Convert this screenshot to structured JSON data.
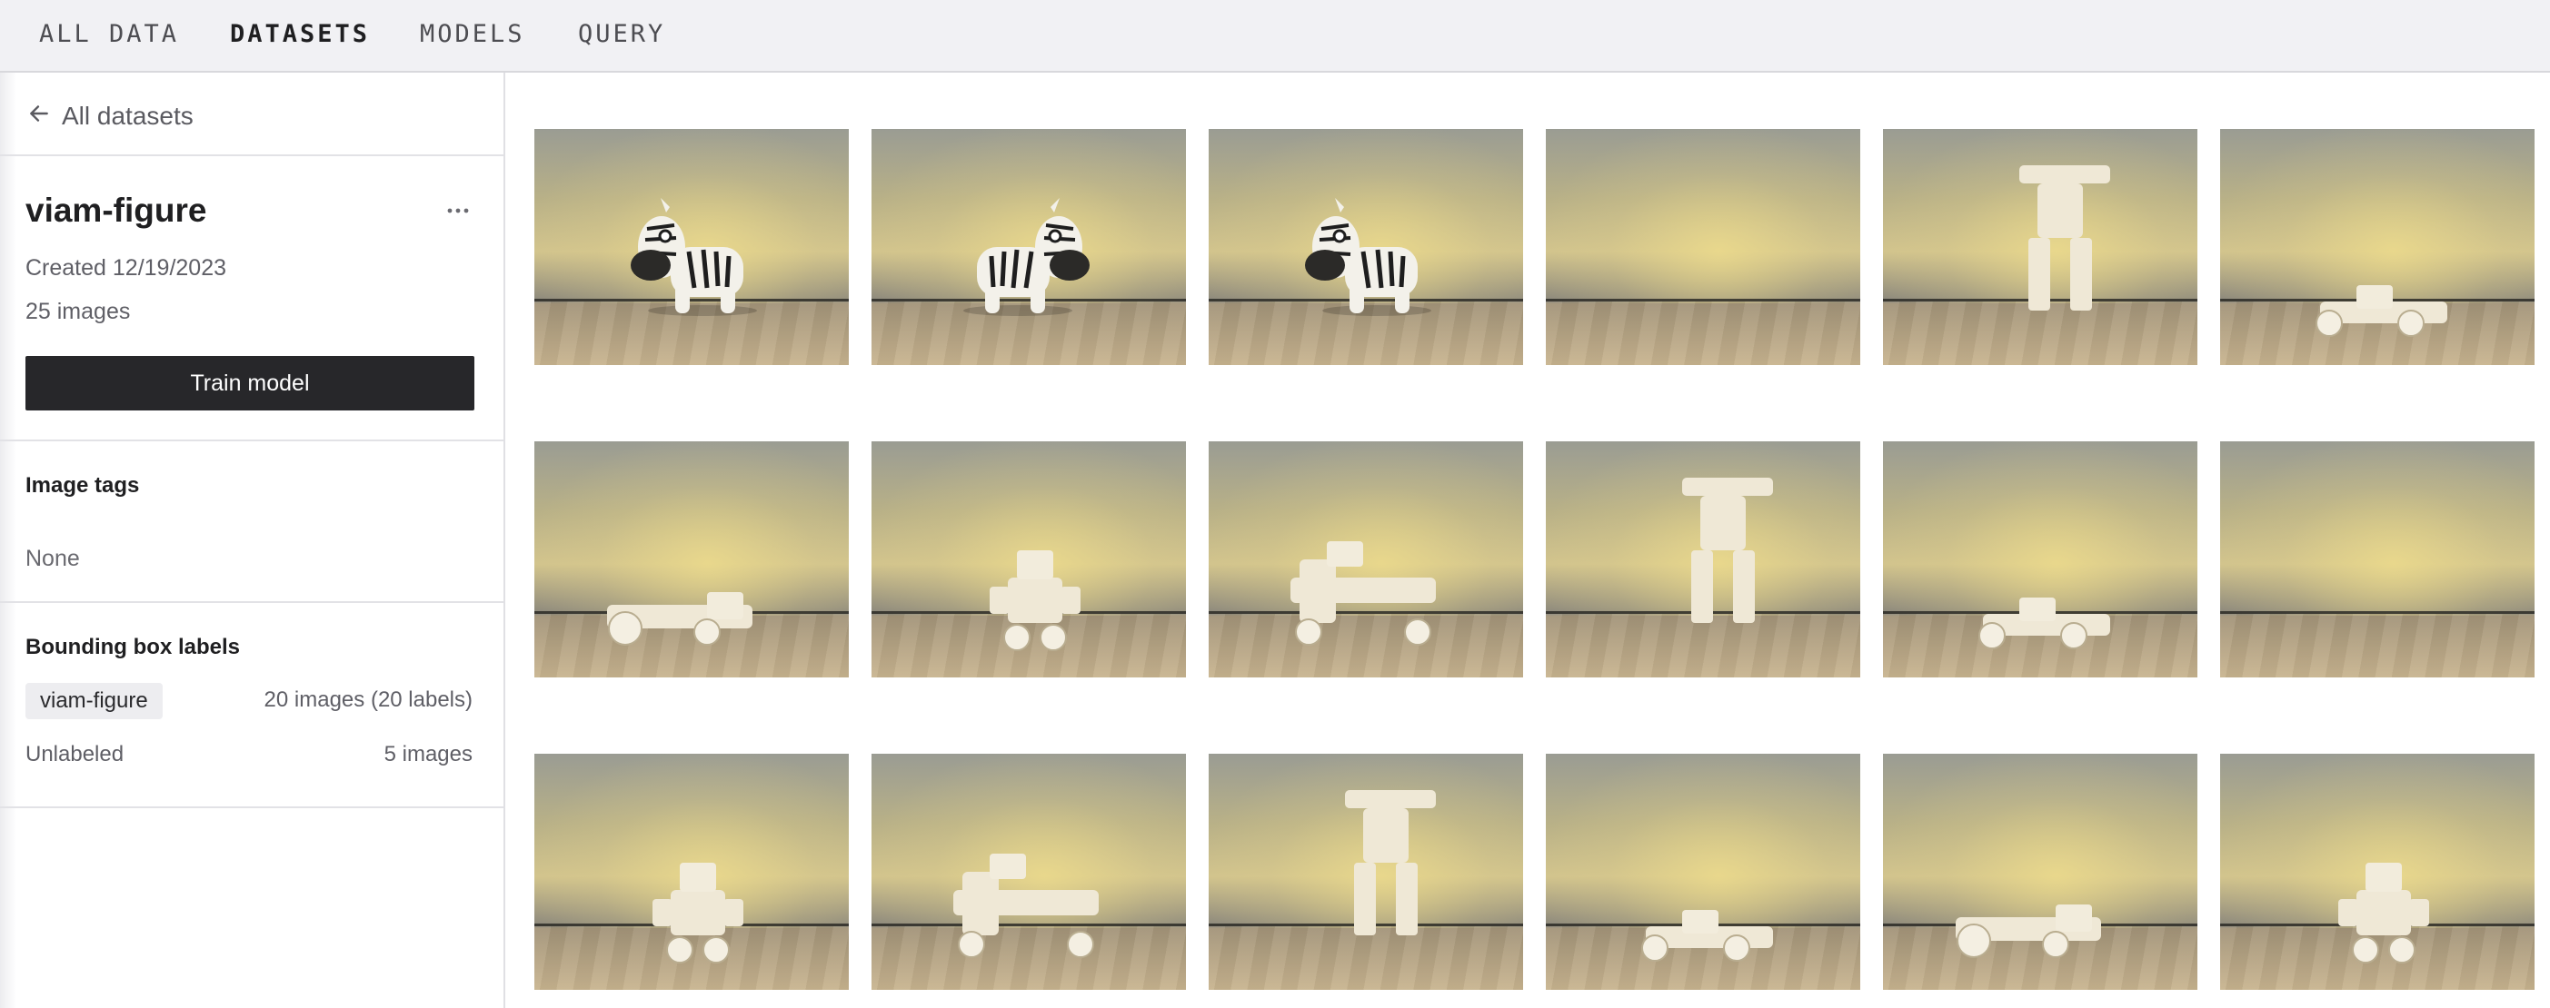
{
  "nav": {
    "tabs": [
      "ALL DATA",
      "DATASETS",
      "MODELS",
      "QUERY"
    ],
    "active": "DATASETS"
  },
  "sidebar": {
    "back_label": "All datasets",
    "dataset_name": "viam-figure",
    "created": "Created 12/19/2023",
    "image_count": "25 images",
    "train_button": "Train model",
    "image_tags_title": "Image tags",
    "image_tags_value": "None",
    "bbox_title": "Bounding box labels",
    "labels": [
      {
        "name": "viam-figure",
        "count": "20 images (20 labels)"
      }
    ],
    "unlabeled": {
      "label": "Unlabeled",
      "count": "5 images"
    }
  },
  "grid": {
    "images": [
      {
        "subject": "zebra"
      },
      {
        "subject": "zebra"
      },
      {
        "subject": "zebra"
      },
      {
        "subject": "empty"
      },
      {
        "subject": "figure"
      },
      {
        "subject": "figure"
      },
      {
        "subject": "figure"
      },
      {
        "subject": "figure"
      },
      {
        "subject": "figure"
      },
      {
        "subject": "figure"
      },
      {
        "subject": "figure"
      },
      {
        "subject": "empty"
      },
      {
        "subject": "figure"
      },
      {
        "subject": "figure"
      },
      {
        "subject": "figure"
      },
      {
        "subject": "figure"
      },
      {
        "subject": "figure"
      },
      {
        "subject": "figure"
      }
    ]
  },
  "colors": {
    "nav_bg": "#f1f1f4",
    "button_bg": "#27272a",
    "chip_bg": "#ededf0"
  }
}
